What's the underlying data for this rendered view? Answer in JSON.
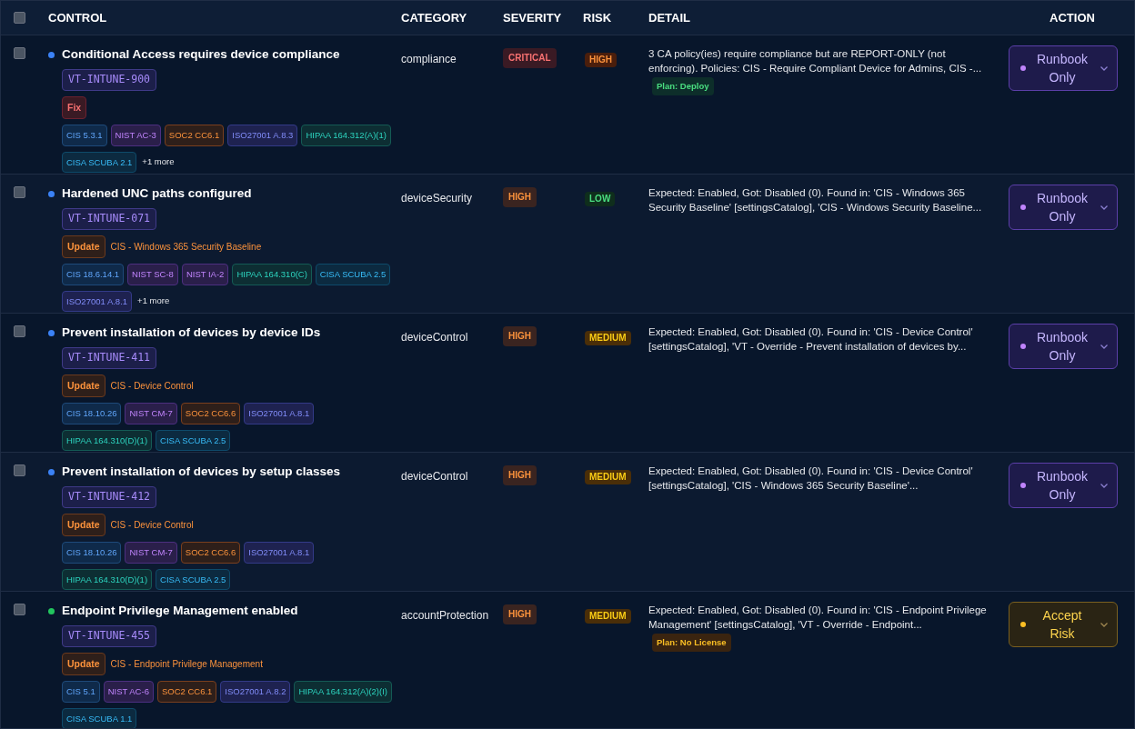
{
  "header": {
    "select_all": {
      "checked": false
    },
    "columns": [
      "CONTROL",
      "CATEGORY",
      "SEVERITY",
      "RISK",
      "DETAIL",
      "ACTION"
    ]
  },
  "rows": [
    {
      "checked": false,
      "color": "#3b82f6",
      "title": "Conditional Access requires device compliance",
      "id": "VT-INTUNE-900",
      "remediation": {
        "kind": "fix",
        "label": "Fix"
      },
      "tags": [
        {
          "kind": "cis",
          "label": "CIS 5.3.1"
        },
        {
          "kind": "nist",
          "label": "NIST AC-3"
        },
        {
          "kind": "soc2",
          "label": "SOC2 CC6.1"
        },
        {
          "kind": "iso",
          "label": "ISO27001 A.8.3"
        },
        {
          "kind": "hipaa",
          "label": "HIPAA 164.312(A)(1)"
        },
        {
          "kind": "cisa",
          "label": "CISA SCUBA 2.1"
        }
      ],
      "more": "+1 more",
      "category": "compliance",
      "severity": {
        "kind": "critical",
        "label": "CRITICAL"
      },
      "risk": {
        "kind": "high",
        "label": "HIGH"
      },
      "detail": "3 CA policy(ies) require compliance but are REPORT-ONLY (not enforcing). Policies: CIS - Require Compliant Device for Admins, CIS -...",
      "plan": {
        "kind": "deploy",
        "label": "Plan: Deploy"
      },
      "action": {
        "kind": "runbook",
        "label": "Runbook Only"
      }
    },
    {
      "checked": false,
      "color": "#3b82f6",
      "title": "Hardened UNC paths configured",
      "id": "VT-INTUNE-071",
      "remediation": {
        "kind": "update",
        "label": "Update",
        "source": "CIS - Windows 365 Security Baseline"
      },
      "tags": [
        {
          "kind": "cis",
          "label": "CIS 18.6.14.1"
        },
        {
          "kind": "nist",
          "label": "NIST SC-8"
        },
        {
          "kind": "nist",
          "label": "NIST IA-2"
        },
        {
          "kind": "hipaa",
          "label": "HIPAA 164.310(C)"
        },
        {
          "kind": "cisa",
          "label": "CISA SCUBA 2.5"
        },
        {
          "kind": "iso",
          "label": "ISO27001 A.8.1"
        }
      ],
      "more": "+1 more",
      "category": "deviceSecurity",
      "severity": {
        "kind": "high",
        "label": "HIGH"
      },
      "risk": {
        "kind": "low",
        "label": "LOW"
      },
      "detail": "Expected: Enabled, Got: Disabled (0). Found in: 'CIS - Windows 365 Security Baseline' [settingsCatalog], 'CIS - Windows Security Baseline...",
      "action": {
        "kind": "runbook",
        "label": "Runbook Only"
      }
    },
    {
      "checked": false,
      "color": "#3b82f6",
      "title": "Prevent installation of devices by device IDs",
      "id": "VT-INTUNE-411",
      "remediation": {
        "kind": "update",
        "label": "Update",
        "source": "CIS - Device Control"
      },
      "tags": [
        {
          "kind": "cis",
          "label": "CIS 18.10.26"
        },
        {
          "kind": "nist",
          "label": "NIST CM-7"
        },
        {
          "kind": "soc2",
          "label": "SOC2 CC6.6"
        },
        {
          "kind": "iso",
          "label": "ISO27001 A.8.1"
        },
        {
          "kind": "hipaa",
          "label": "HIPAA 164.310(D)(1)"
        },
        {
          "kind": "cisa",
          "label": "CISA SCUBA 2.5"
        }
      ],
      "category": "deviceControl",
      "severity": {
        "kind": "high",
        "label": "HIGH"
      },
      "risk": {
        "kind": "medium",
        "label": "MEDIUM"
      },
      "detail": "Expected: Enabled, Got: Disabled (0). Found in: 'CIS - Device Control' [settingsCatalog], 'VT - Override - Prevent installation of devices by...",
      "action": {
        "kind": "runbook",
        "label": "Runbook Only"
      }
    },
    {
      "checked": false,
      "color": "#3b82f6",
      "title": "Prevent installation of devices by setup classes",
      "id": "VT-INTUNE-412",
      "remediation": {
        "kind": "update",
        "label": "Update",
        "source": "CIS - Device Control"
      },
      "tags": [
        {
          "kind": "cis",
          "label": "CIS 18.10.26"
        },
        {
          "kind": "nist",
          "label": "NIST CM-7"
        },
        {
          "kind": "soc2",
          "label": "SOC2 CC6.6"
        },
        {
          "kind": "iso",
          "label": "ISO27001 A.8.1"
        },
        {
          "kind": "hipaa",
          "label": "HIPAA 164.310(D)(1)"
        },
        {
          "kind": "cisa",
          "label": "CISA SCUBA 2.5"
        }
      ],
      "category": "deviceControl",
      "severity": {
        "kind": "high",
        "label": "HIGH"
      },
      "risk": {
        "kind": "medium",
        "label": "MEDIUM"
      },
      "detail": "Expected: Enabled, Got: Disabled (0). Found in: 'CIS - Device Control' [settingsCatalog], 'CIS - Windows 365 Security Baseline'...",
      "action": {
        "kind": "runbook",
        "label": "Runbook Only"
      }
    },
    {
      "checked": false,
      "color": "#22c55e",
      "title": "Endpoint Privilege Management enabled",
      "id": "VT-INTUNE-455",
      "remediation": {
        "kind": "update",
        "label": "Update",
        "source": "CIS - Endpoint Privilege Management"
      },
      "tags": [
        {
          "kind": "cis",
          "label": "CIS 5.1"
        },
        {
          "kind": "nist",
          "label": "NIST AC-6"
        },
        {
          "kind": "soc2",
          "label": "SOC2 CC6.1"
        },
        {
          "kind": "iso",
          "label": "ISO27001 A.8.2"
        },
        {
          "kind": "hipaa",
          "label": "HIPAA 164.312(A)(2)(I)"
        },
        {
          "kind": "cisa",
          "label": "CISA SCUBA 1.1"
        }
      ],
      "category": "accountProtection",
      "severity": {
        "kind": "high",
        "label": "HIGH"
      },
      "risk": {
        "kind": "medium",
        "label": "MEDIUM"
      },
      "detail": "Expected: Enabled, Got: Disabled (0). Found in: 'CIS - Endpoint Privilege Management' [settingsCatalog], 'VT - Override - Endpoint...",
      "plan": {
        "kind": "nolicense",
        "label": "Plan: No License"
      },
      "action": {
        "kind": "accept",
        "label": "Accept Risk"
      }
    }
  ]
}
